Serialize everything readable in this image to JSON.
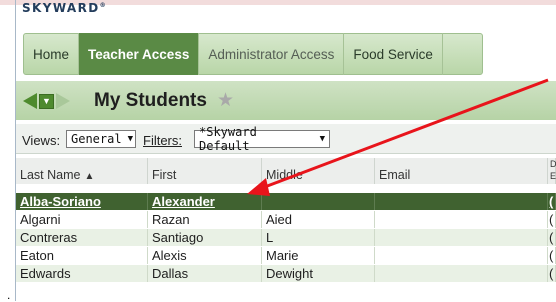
{
  "app": {
    "logo": "SKYWARD",
    "logo_mark": "®"
  },
  "nav": {
    "tabs": [
      "Home",
      "Teacher Access",
      "Administrator Access",
      "Food Service"
    ],
    "active": "Teacher Access"
  },
  "page": {
    "title": "My Students",
    "favorite_icon": "star-icon"
  },
  "views": {
    "label": "Views:",
    "value": "General",
    "caret": "▼"
  },
  "filters": {
    "label": "Filters:",
    "value": "*Skyward Default",
    "caret": "▼"
  },
  "table": {
    "columns": [
      "Last Name",
      "First",
      "Middle",
      "Email",
      "D E"
    ],
    "sort_indicator": "▲",
    "rows": [
      {
        "last": "Alba-Soriano",
        "first": "Alexander",
        "middle": "",
        "email": "",
        "extra": "("
      },
      {
        "last": "Algarni",
        "first": "Razan",
        "middle": "Aied",
        "email": "",
        "extra": "("
      },
      {
        "last": "Contreras",
        "first": "Santiago",
        "middle": "L",
        "email": "",
        "extra": "("
      },
      {
        "last": "Eaton",
        "first": "Alexis",
        "middle": "Marie",
        "email": "",
        "extra": "("
      },
      {
        "last": "Edwards",
        "first": "Dallas",
        "middle": "Dewight",
        "email": "",
        "extra": "("
      }
    ]
  },
  "colors": {
    "active_tab": "#5a8a45",
    "selected_row": "#406230",
    "annotation_arrow": "#e8141b"
  },
  "misc": {
    "dot": "."
  }
}
